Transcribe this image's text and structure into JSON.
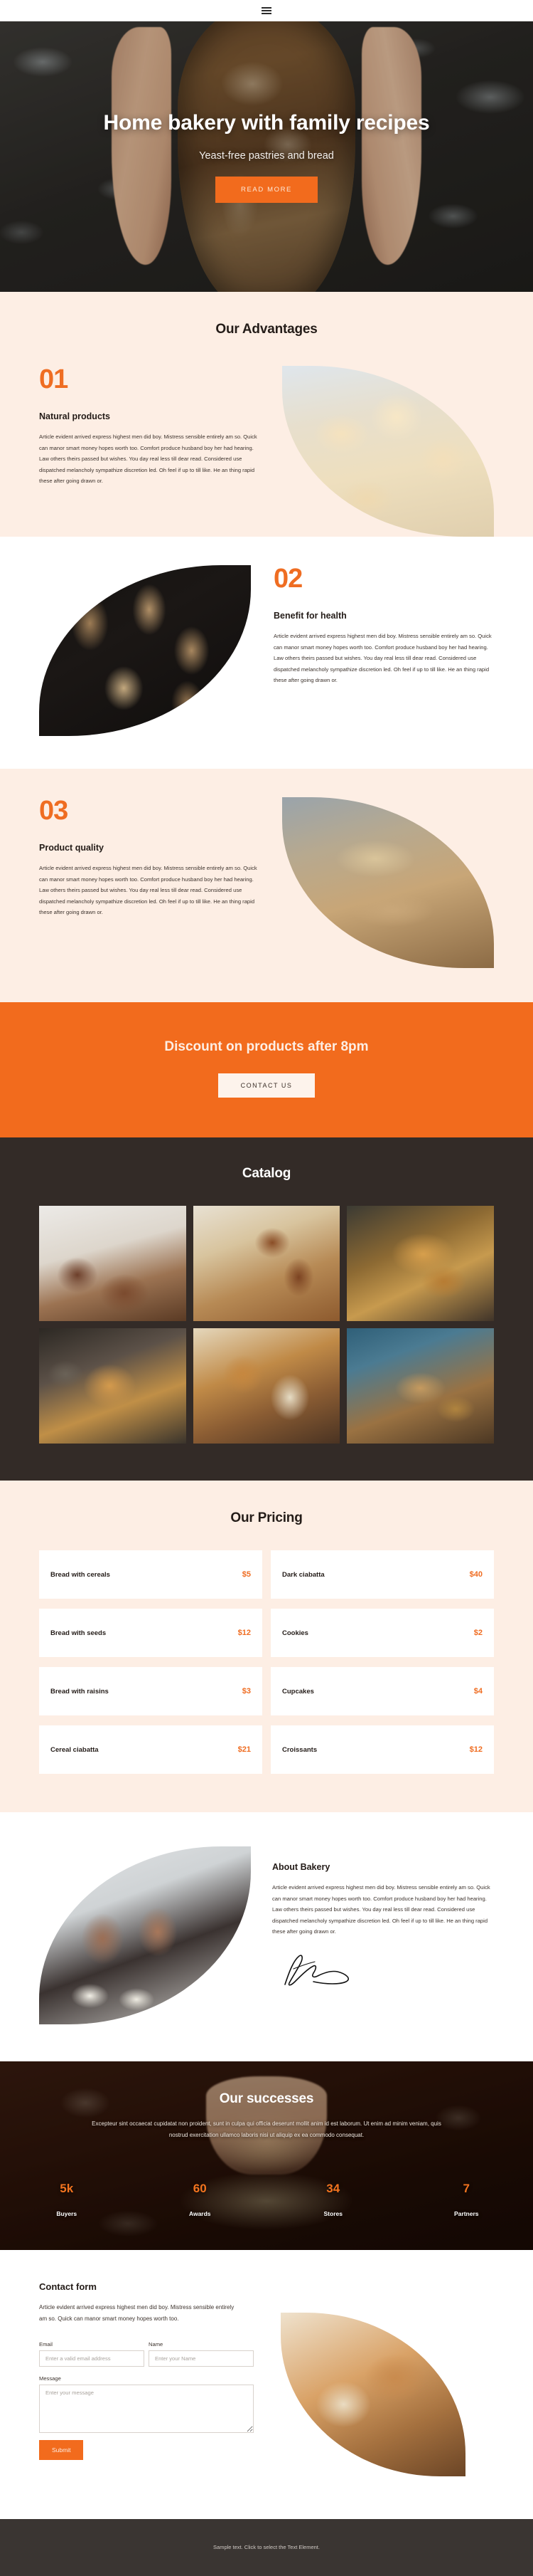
{
  "header": {
    "menu_icon": "hamburger-menu-icon"
  },
  "hero": {
    "title": "Home bakery with family recipes",
    "subtitle": "Yeast-free pastries and bread",
    "cta": "READ MORE"
  },
  "advantages": {
    "title": "Our Advantages",
    "items": [
      {
        "number": "01",
        "heading": "Natural products",
        "body": "Article evident arrived express highest men did boy. Mistress sensible entirely am so. Quick can manor smart money hopes worth too. Comfort produce husband boy her had hearing. Law others theirs passed but wishes. You day real less till dear read. Considered use dispatched melancholy sympathize discretion led. Oh feel if up to till like. He an thing rapid these after going drawn or."
      },
      {
        "number": "02",
        "heading": "Benefit for health",
        "body": "Article evident arrived express highest men did boy. Mistress sensible entirely am so. Quick can manor smart money hopes worth too. Comfort produce husband boy her had hearing. Law others theirs passed but wishes. You day real less till dear read. Considered use dispatched melancholy sympathize discretion led. Oh feel if up to till like. He an thing rapid these after going drawn or."
      },
      {
        "number": "03",
        "heading": "Product quality",
        "body": "Article evident arrived express highest men did boy. Mistress sensible entirely am so. Quick can manor smart money hopes worth too. Comfort produce husband boy her had hearing. Law others theirs passed but wishes. You day real less till dear read. Considered use dispatched melancholy sympathize discretion led. Oh feel if up to till like. He an thing rapid these after going drawn or."
      }
    ]
  },
  "discount": {
    "title": "Discount on products after 8pm",
    "cta": "CONTACT US"
  },
  "catalog": {
    "title": "Catalog",
    "images": [
      "dark-sourdough-loaves-photo",
      "braided-pastry-on-board-photo",
      "golden-crusty-loaf-photo",
      "round-loaf-with-wheat-photo",
      "sliced-seeded-bread-photo",
      "baguettes-on-blue-photo"
    ]
  },
  "pricing": {
    "title": "Our Pricing",
    "items": [
      {
        "name": "Bread with cereals",
        "price": "$5"
      },
      {
        "name": "Dark ciabatta",
        "price": "$40"
      },
      {
        "name": "Bread with seeds",
        "price": "$12"
      },
      {
        "name": "Cookies",
        "price": "$2"
      },
      {
        "name": "Bread with raisins",
        "price": "$3"
      },
      {
        "name": "Cupcakes",
        "price": "$4"
      },
      {
        "name": "Cereal ciabatta",
        "price": "$21"
      },
      {
        "name": "Croissants",
        "price": "$12"
      }
    ]
  },
  "about": {
    "heading": "About Bakery",
    "body": "Article evident arrived express highest men did boy. Mistress sensible entirely am so. Quick can manor smart money hopes worth too. Comfort produce husband boy her had hearing. Law others theirs passed but wishes. You day real less till dear read. Considered use dispatched melancholy sympathize discretion led. Oh feel if up to till like. He an thing rapid these after going drawn or.",
    "signature": "handwritten-signature-image",
    "image": "baker-kneading-dough-photo"
  },
  "successes": {
    "title": "Our successes",
    "body": "Excepteur sint occaecat cupidatat non proident, sunt in culpa qui officia deserunt mollit anim id est laborum. Ut enim ad minim veniam, quis nostrud exercitation ullamco laboris nisi ut aliquip ex ea commodo consequat.",
    "stats": [
      {
        "value": "5k",
        "label": "Buyers"
      },
      {
        "value": "60",
        "label": "Awards"
      },
      {
        "value": "34",
        "label": "Stores"
      },
      {
        "value": "7",
        "label": "Partners"
      }
    ]
  },
  "contact": {
    "heading": "Contact form",
    "body": "Article evident arrived express highest men did boy. Mistress sensible entirely am so. Quick can manor smart money hopes worth too.",
    "email_label": "Email",
    "email_placeholder": "Enter a valid email address",
    "email_value": "",
    "name_label": "Name",
    "name_placeholder": "Enter your Name",
    "name_value": "",
    "message_label": "Message",
    "message_placeholder": "Enter your message",
    "message_value": "",
    "submit": "Submit",
    "image": "sliced-seeded-loaf-photo"
  },
  "footer": {
    "text": "Sample text. Click to select the Text Element."
  },
  "colors": {
    "accent": "#f26b1d",
    "cream": "#fdeee4",
    "dark": "#332b27",
    "footer": "#3a3532"
  }
}
